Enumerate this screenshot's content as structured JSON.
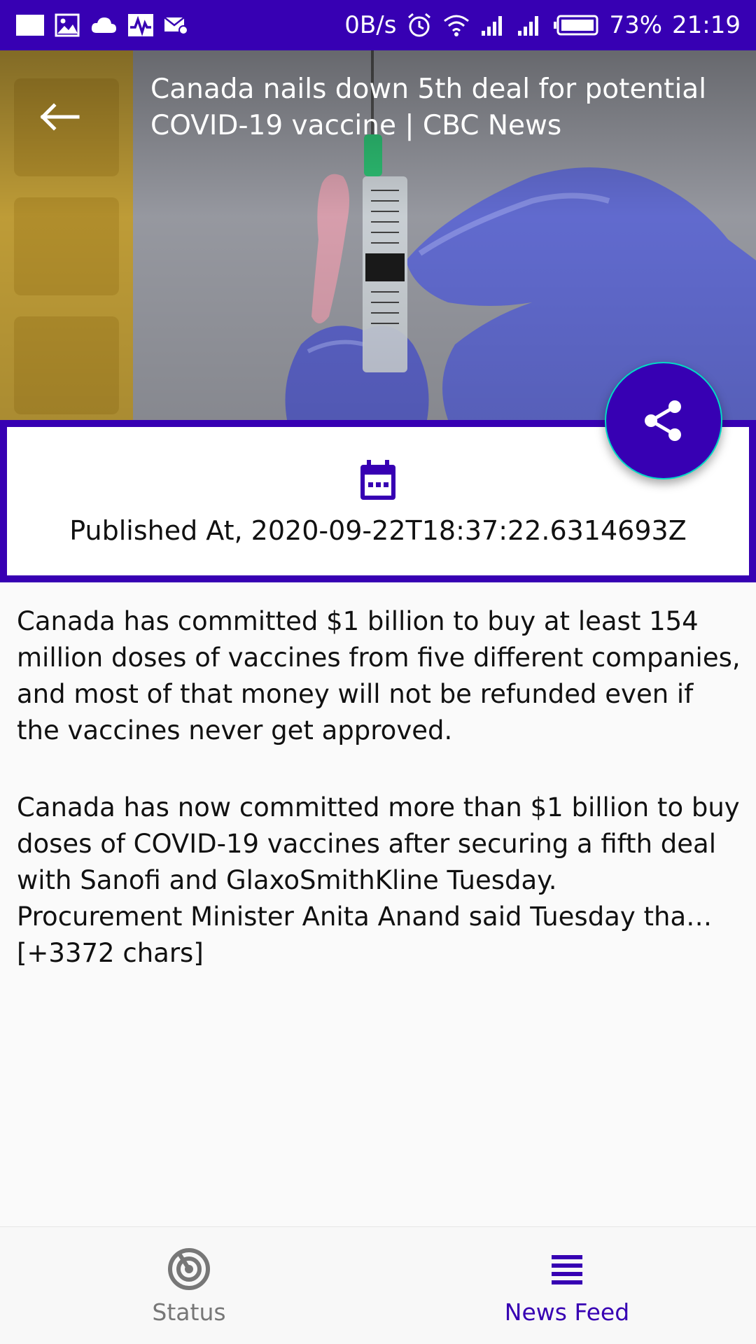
{
  "status_bar": {
    "network_speed": "0B/s",
    "battery_percent": "73%",
    "time": "21:19",
    "left_icons": [
      "notification-square-icon",
      "gallery-icon",
      "cloud-icon",
      "activity-icon",
      "mail-settings-icon"
    ],
    "right_icons": [
      "alarm-icon",
      "wifi-icon",
      "signal-icon",
      "signal-icon",
      "battery-icon"
    ]
  },
  "header": {
    "title": "Canada nails down 5th deal for potential COVID-19 vaccine | CBC News"
  },
  "published": {
    "text": "Published At, 2020-09-22T18:37:22.6314693Z"
  },
  "article": {
    "paragraph_1": "Canada has committed $1 billion to buy at least 154 million doses of vaccines from five different companies, and most of that money will not be refunded even if the vaccines never get approved.",
    "paragraph_2_line_1": "Canada has now committed more than $1 billion to buy doses of COVID-19 vaccines after securing a fifth deal with Sanofi and GlaxoSmithKline Tuesday.",
    "paragraph_2_line_2": "Procurement Minister Anita Anand said Tuesday tha… [+3372 chars]"
  },
  "bottom_nav": {
    "items": [
      {
        "label": "Status",
        "icon": "radar-icon",
        "active": false
      },
      {
        "label": "News Feed",
        "icon": "list-icon",
        "active": true
      }
    ]
  },
  "colors": {
    "primary": "#3700b3",
    "accent": "#03dac5",
    "inactive": "#777777"
  }
}
